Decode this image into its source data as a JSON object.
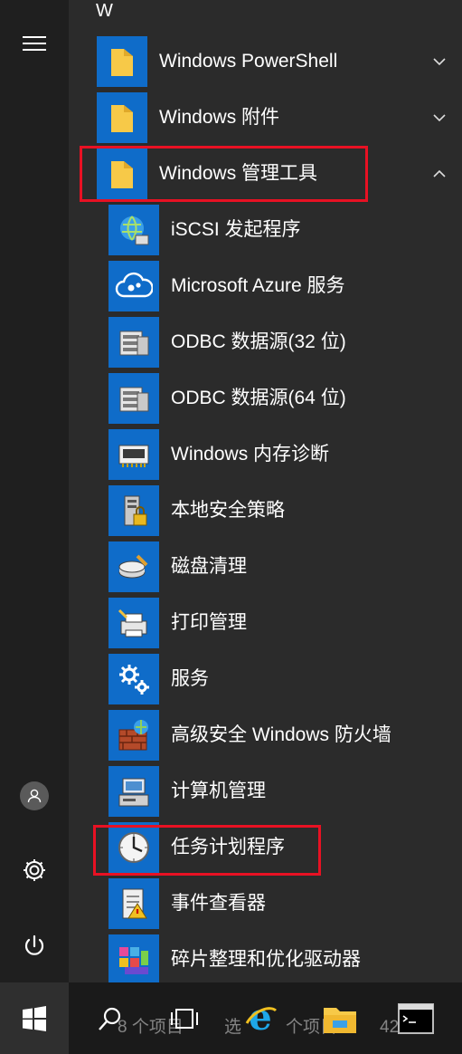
{
  "start_menu": {
    "section_letter": "W",
    "folders": [
      {
        "label": "Windows PowerShell",
        "expanded": false
      },
      {
        "label": "Windows 附件",
        "expanded": false
      },
      {
        "label": "Windows 管理工具",
        "expanded": true
      }
    ],
    "admin_tools": [
      {
        "label": "iSCSI 发起程序",
        "icon": "iscsi-globe-icon"
      },
      {
        "label": "Microsoft Azure 服务",
        "icon": "azure-cloud-icon"
      },
      {
        "label": "ODBC 数据源(32 位)",
        "icon": "odbc-database-icon"
      },
      {
        "label": "ODBC 数据源(64 位)",
        "icon": "odbc-database-icon"
      },
      {
        "label": "Windows 内存诊断",
        "icon": "memory-chip-icon"
      },
      {
        "label": "本地安全策略",
        "icon": "security-policy-icon"
      },
      {
        "label": "磁盘清理",
        "icon": "disk-cleanup-icon"
      },
      {
        "label": "打印管理",
        "icon": "print-management-icon"
      },
      {
        "label": "服务",
        "icon": "gears-icon"
      },
      {
        "label": "高级安全 Windows 防火墙",
        "icon": "firewall-icon"
      },
      {
        "label": "计算机管理",
        "icon": "computer-management-icon"
      },
      {
        "label": "任务计划程序",
        "icon": "clock-icon"
      },
      {
        "label": "事件查看器",
        "icon": "event-viewer-icon"
      },
      {
        "label": "碎片整理和优化驱动器",
        "icon": "defrag-icon"
      }
    ]
  },
  "left_rail": {
    "menu_icon": "hamburger-icon",
    "user_icon": "user-icon",
    "settings_icon": "gear-icon",
    "power_icon": "power-icon"
  },
  "taskbar": {
    "items": [
      "start-windows-icon",
      "search-icon",
      "task-view-icon",
      "internet-explorer-icon",
      "file-explorer-icon",
      "command-prompt-icon"
    ],
    "background_status_1": "8 个项目",
    "background_status_2": "选",
    "background_status_3": "个项目",
    "background_status_4": "427 字"
  },
  "colors": {
    "tile_blue": "#0f6cc9",
    "highlight_red": "#e81123",
    "menu_bg": "#2b2b2b",
    "rail_bg": "#1f1f1f"
  }
}
